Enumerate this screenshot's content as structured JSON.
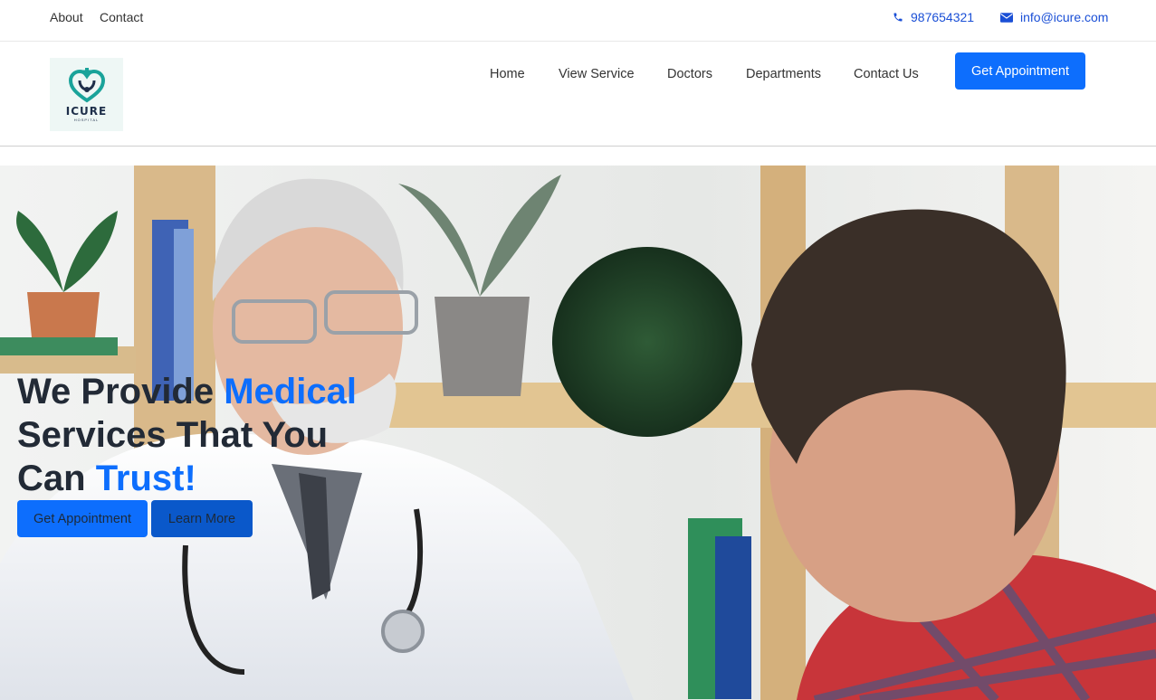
{
  "topbar": {
    "about": "About",
    "contact": "Contact",
    "phone": "987654321",
    "email": "info@icure.com",
    "phone_icon": "phone-icon",
    "email_icon": "envelope-icon"
  },
  "header": {
    "logo_text": "ICURE",
    "logo_subtext": "HOSPITAL",
    "nav": [
      "Home",
      "View Service",
      "Doctors",
      "Departments",
      "Contact Us"
    ],
    "cta": "Get Appointment"
  },
  "hero": {
    "title_part1": "We Provide ",
    "title_accent1": "Medical",
    "title_part2": "Services That You",
    "title_part3": "Can ",
    "title_accent2": "Trust!",
    "primary_button": "Get Appointment",
    "secondary_button": "Learn More"
  },
  "colors": {
    "accent": "#0d6efd",
    "accent_dark": "#0a58ca",
    "link": "#1a4fd6"
  }
}
